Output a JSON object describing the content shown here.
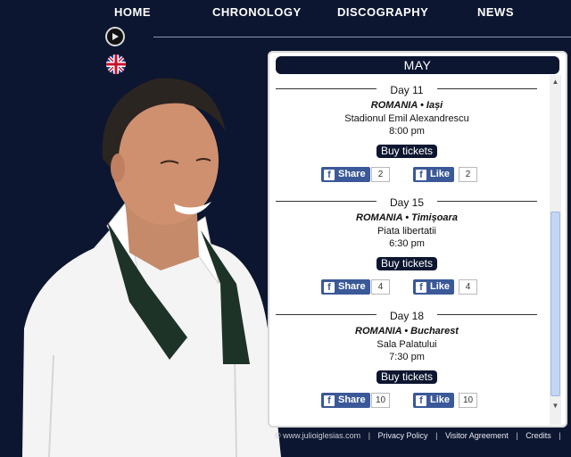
{
  "nav": {
    "items": [
      {
        "label": "HOME"
      },
      {
        "label": "CHRONOLOGY"
      },
      {
        "label": "DISCOGRAPHY"
      },
      {
        "label": "NEWS"
      }
    ]
  },
  "panel": {
    "month": "MAY",
    "buy_label": "Buy tickets",
    "share_label": "Share",
    "like_label": "Like",
    "events": [
      {
        "day": "Day 11",
        "country": "ROMANIA",
        "separator": "•",
        "city": "Iași",
        "venue": "Stadionul Emil Alexandrescu",
        "time": "8:00 pm",
        "share_count": "2",
        "like_count": "2"
      },
      {
        "day": "Day 15",
        "country": "ROMANIA",
        "separator": "•",
        "city": "Timișoara",
        "venue": "Piata libertatii",
        "time": "6:30 pm",
        "share_count": "4",
        "like_count": "4"
      },
      {
        "day": "Day 18",
        "country": "ROMANIA",
        "separator": "•",
        "city": "Bucharest",
        "venue": "Sala Palatului",
        "time": "7:30 pm",
        "share_count": "10",
        "like_count": "10"
      }
    ]
  },
  "footer": {
    "copyright": "© www.julioiglesias.com",
    "separator": "|",
    "links": [
      "Privacy Policy",
      "Visitor Agreement",
      "Credits"
    ]
  },
  "colors": {
    "background": "#0c1630",
    "facebook": "#3b5998",
    "panel": "#ffffff"
  },
  "icons": {
    "play": "play-icon",
    "flag": "uk-flag-icon",
    "facebook": "facebook-icon"
  }
}
